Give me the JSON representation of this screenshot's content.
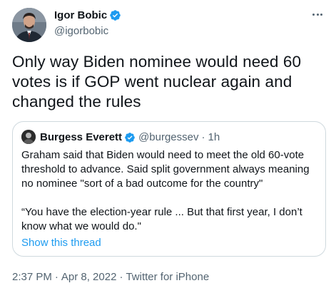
{
  "tweet": {
    "author_name": "Igor Bobic",
    "author_handle": "@igorbobic",
    "text": "Only way Biden nominee would need 60 votes is if GOP went nuclear again and changed the rules",
    "timestamp_time": "2:37 PM",
    "separator": "·",
    "timestamp_date": "Apr 8, 2022",
    "source": "Twitter for iPhone",
    "more_icon": "more-horizontal-icon"
  },
  "quote": {
    "author_name": "Burgess Everett",
    "author_handle": "@burgessev",
    "separator": "·",
    "time_ago": "1h",
    "paragraphs": [
      "Graham said that Biden would need to meet the old 60-vote threshold to advance. Said split government always meaning no nominee \"sort of a bad outcome for the country\"",
      "“You have the election-year rule ... But that first year, I don’t know what we would do.\""
    ],
    "show_thread": "Show this thread"
  },
  "colors": {
    "text": "#0f1419",
    "muted": "#536471",
    "accent": "#1d9bf0",
    "border": "#cfd9de"
  }
}
